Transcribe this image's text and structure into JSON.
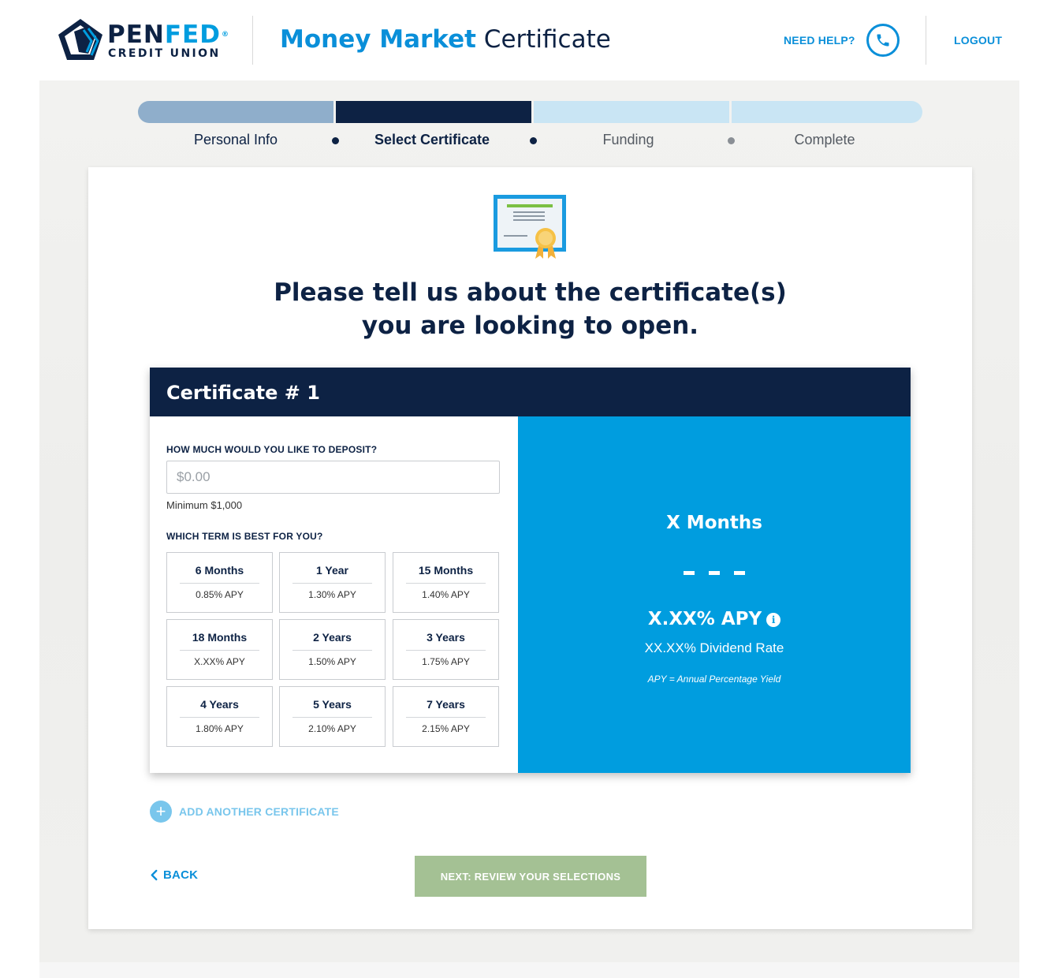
{
  "header": {
    "logo_pen": "PEN",
    "logo_fed": "FED",
    "logo_reg": "®",
    "logo_sub": "CREDIT UNION",
    "title_bold": "Money Market",
    "title_rest": "Certificate",
    "need_help": "NEED HELP?",
    "logout": "LOGOUT"
  },
  "progress": {
    "steps": [
      {
        "label": "Personal Info",
        "state": "done"
      },
      {
        "label": "Select Certificate",
        "state": "active"
      },
      {
        "label": "Funding",
        "state": "todo"
      },
      {
        "label": "Complete",
        "state": "todo"
      }
    ]
  },
  "main": {
    "heading_line1": "Please tell us about the certificate(s)",
    "heading_line2": "you are looking to open."
  },
  "certificate": {
    "title": "Certificate # 1",
    "deposit_question": "HOW MUCH WOULD YOU LIKE TO DEPOSIT?",
    "deposit_placeholder": "$0.00",
    "deposit_value": "",
    "minimum_note": "Minimum $1,000",
    "term_question": "WHICH TERM IS BEST FOR YOU?",
    "terms": [
      {
        "name": "6 Months",
        "apy": "0.85% APY"
      },
      {
        "name": "1 Year",
        "apy": "1.30% APY"
      },
      {
        "name": "15 Months",
        "apy": "1.40% APY"
      },
      {
        "name": "18 Months",
        "apy": "X.XX% APY"
      },
      {
        "name": "2 Years",
        "apy": "1.50% APY"
      },
      {
        "name": "3 Years",
        "apy": "1.75% APY"
      },
      {
        "name": "4 Years",
        "apy": "1.80% APY"
      },
      {
        "name": "5 Years",
        "apy": "2.10% APY"
      },
      {
        "name": "7 Years",
        "apy": "2.15% APY"
      }
    ],
    "summary": {
      "term": "X Months",
      "apy": "X.XX% APY",
      "dividend_rate": "XX.XX% Dividend Rate",
      "note": "APY = Annual Percentage Yield",
      "info_glyph": "i"
    }
  },
  "actions": {
    "add_another": "ADD ANOTHER CERTIFICATE",
    "add_glyph": "+",
    "back": "BACK",
    "next": "NEXT: REVIEW YOUR SELECTIONS"
  },
  "colors": {
    "navy": "#0d2244",
    "brand_blue": "#009ddf",
    "link_blue": "#0a8fd9",
    "progress_done": "#8faecb",
    "progress_todo": "#c9e5f4",
    "next_button": "#a4c194"
  },
  "icons": {
    "logo": "penfed-pentagon-icon",
    "phone": "phone-icon",
    "certificate": "certificate-icon",
    "info": "info-icon",
    "plus": "plus-icon",
    "back": "chevron-left-icon"
  }
}
